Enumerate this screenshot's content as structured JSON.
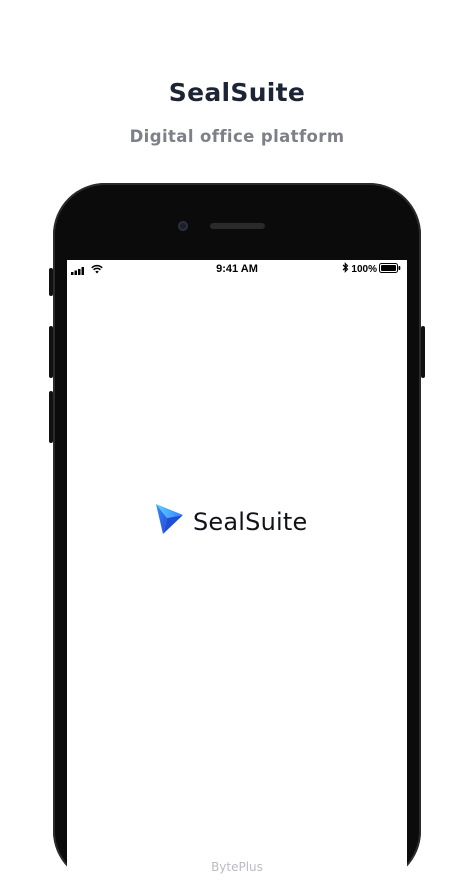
{
  "headline": "SealSuite",
  "subheadline": "Digital office platform",
  "status_bar": {
    "time": "9:41 AM",
    "battery_percent": "100%",
    "signal_icon": "signal-bars-icon",
    "wifi_icon": "wifi-icon",
    "bluetooth_icon": "bluetooth-icon",
    "battery_icon": "battery-icon"
  },
  "splash": {
    "logo_icon": "sealsuite-logo-icon",
    "brand_name": "SealSuite",
    "footer": "BytePlus"
  },
  "colors": {
    "logo_dark_blue": "#1f4fd8",
    "logo_mid_blue": "#3d8bff",
    "logo_light_blue": "#5fd1ff",
    "headline": "#1d2435",
    "subheadline": "#7d8088",
    "footer": "#b9bcc3"
  }
}
